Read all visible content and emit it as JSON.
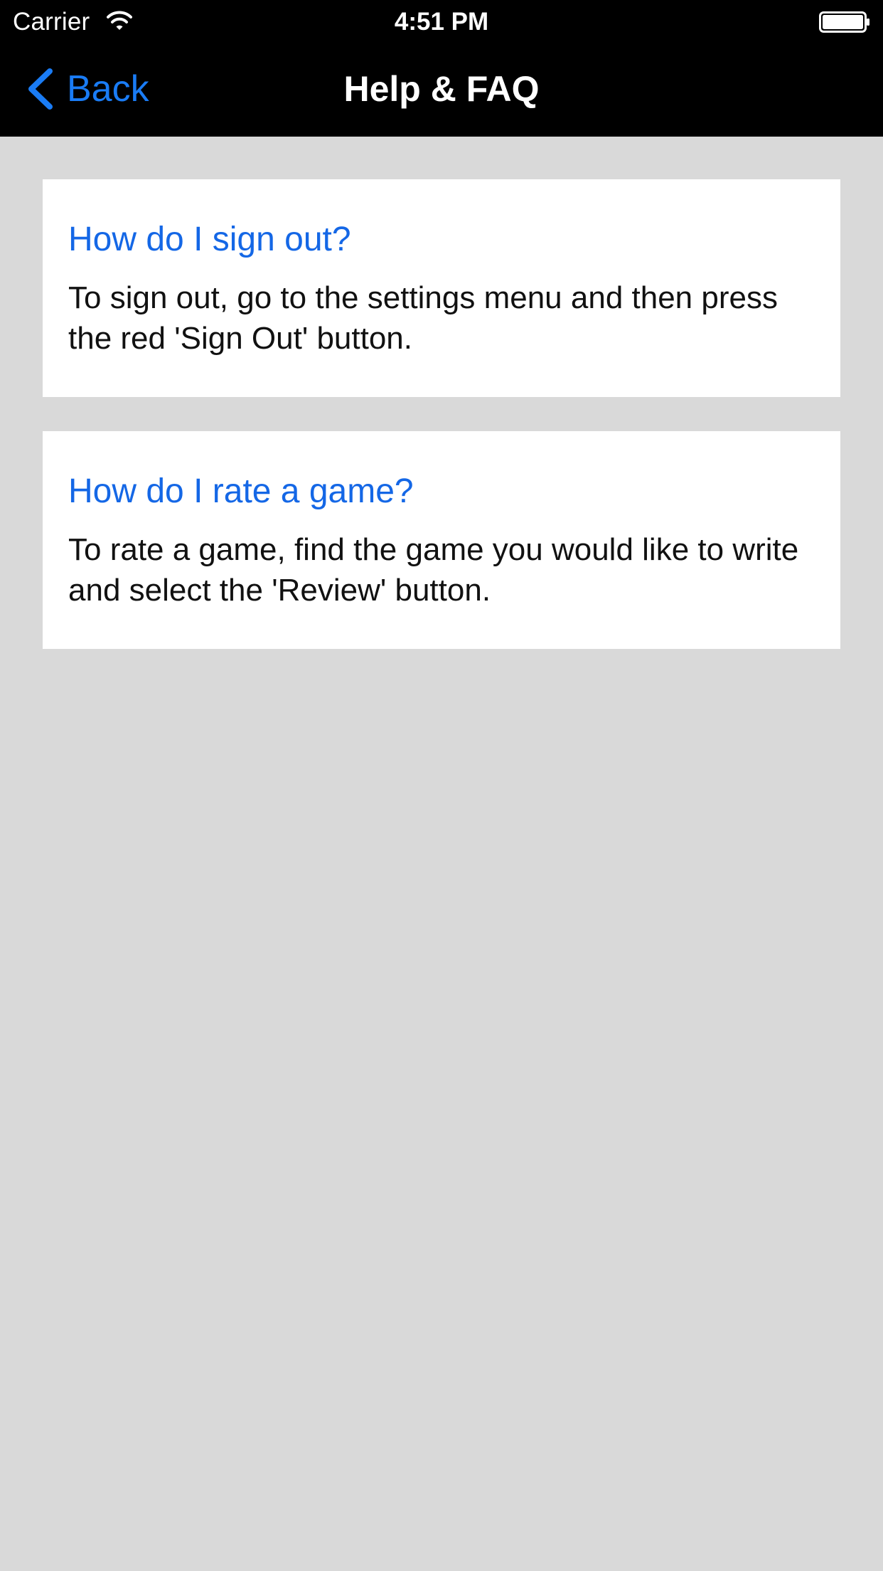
{
  "status_bar": {
    "carrier": "Carrier",
    "time": "4:51 PM",
    "wifi_icon": "wifi-icon",
    "battery_icon": "battery-icon"
  },
  "nav_bar": {
    "back_label": "Back",
    "back_icon": "chevron-left-icon",
    "title": "Help & FAQ"
  },
  "colors": {
    "background": "#d9d9d9",
    "top_bar": "#000000",
    "accent": "#1a7cf5",
    "question_text": "#1467e6",
    "card": "#ffffff"
  },
  "faq": [
    {
      "question": "How do I sign out?",
      "answer": "To sign out, go to the settings menu and then press the red 'Sign Out' button."
    },
    {
      "question": "How do I rate a game?",
      "answer": "To rate a game, find the game you would like to write and select the 'Review' button."
    }
  ]
}
